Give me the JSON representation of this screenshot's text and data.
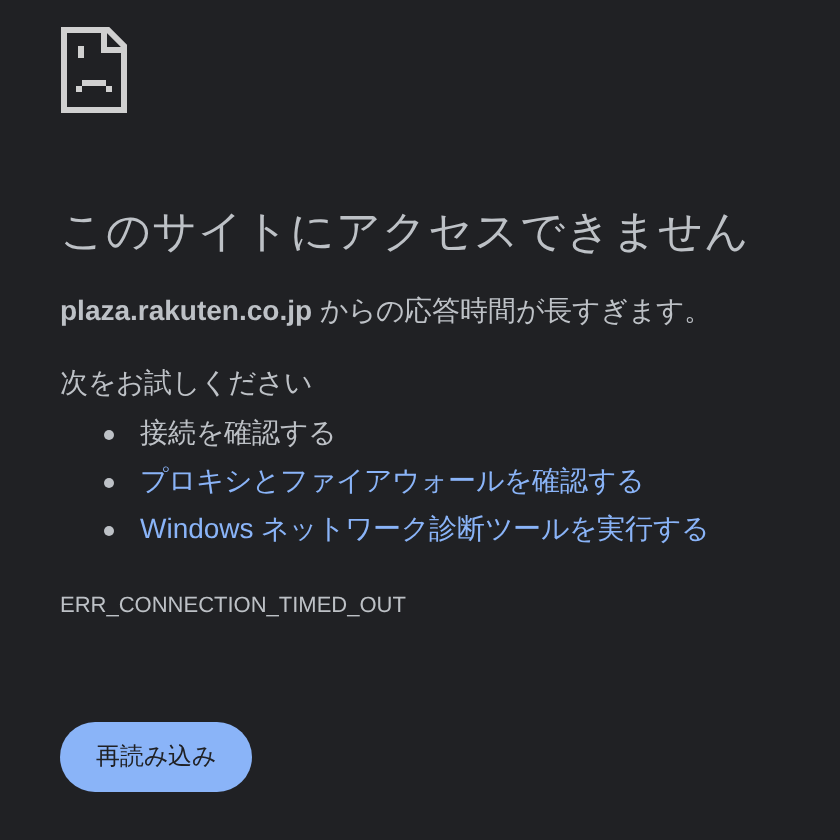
{
  "heading": "このサイトにアクセスできません",
  "message": {
    "host": "plaza.rakuten.co.jp",
    "text": "からの応答時間が長すぎます。"
  },
  "suggestions_title": "次をお試しください",
  "suggestions": [
    {
      "kind": "text",
      "label": "接続を確認する"
    },
    {
      "kind": "link",
      "label": "プロキシとファイアウォールを確認する"
    },
    {
      "kind": "link",
      "label": "Windows ネットワーク診断ツールを実行する"
    }
  ],
  "error_code": "ERR_CONNECTION_TIMED_OUT",
  "reload_button": "再読み込み"
}
